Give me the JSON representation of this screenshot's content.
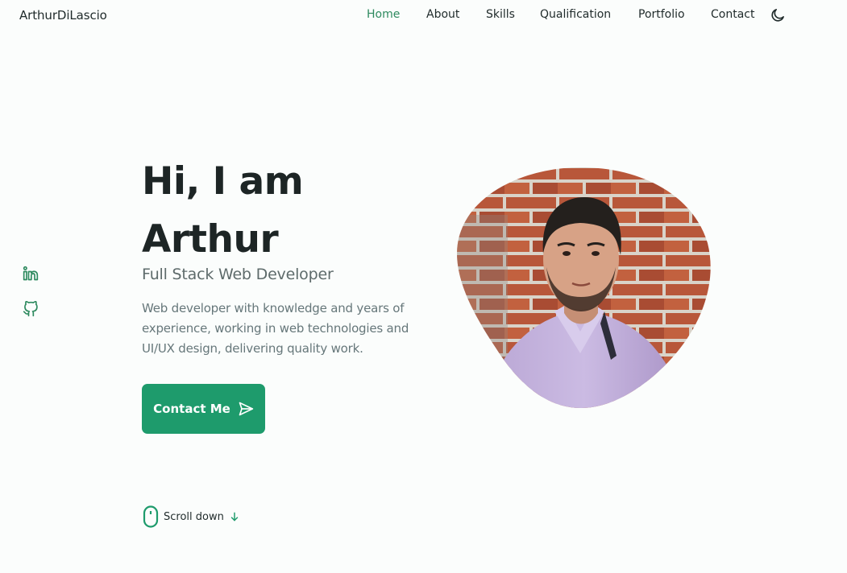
{
  "header": {
    "logo": "ArthurDiLascio",
    "nav": [
      {
        "label": "Home",
        "active": true
      },
      {
        "label": "About"
      },
      {
        "label": "Skills"
      },
      {
        "label": "Qualification"
      },
      {
        "label": "Portfolio"
      },
      {
        "label": "Contact"
      }
    ],
    "theme_icon": "moon-icon"
  },
  "social": {
    "icons": [
      "linkedin-icon",
      "github-icon"
    ]
  },
  "hero": {
    "title_line1": "Hi, I am",
    "title_line2": "Arthur",
    "subtitle": "Full Stack Web Developer",
    "description": "Web developer with knowledge and years of experience, working in web technologies and UI/UX design, delivering quality work.",
    "cta_label": "Contact Me",
    "cta_icon": "send-icon"
  },
  "scroll": {
    "label": "Scroll down",
    "mouse_icon": "mouse-icon",
    "arrow_icon": "arrow-down-icon"
  },
  "colors": {
    "accent": "#1e9b6c",
    "active_nav": "#2e8a5f",
    "background": "#fbfdfc"
  }
}
